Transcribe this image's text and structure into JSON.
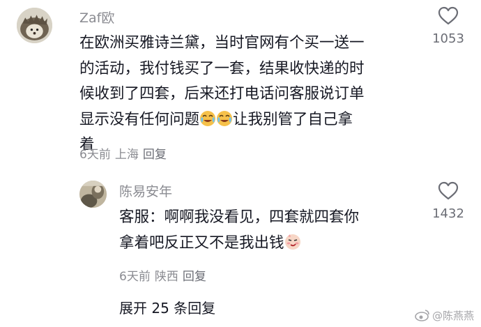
{
  "comment": {
    "author": "Zaf欧",
    "lines": [
      "在欧洲买雅诗兰黛，当时官网有个买一送一",
      "的活动，我付钱买了一套，结果收快递的时",
      "候收到了四套，后来还打电话问客服说订单",
      "显示没有任何问题",
      "让我别管了自己拿",
      "着"
    ],
    "time": "6天前",
    "location": "上海",
    "reply_label": "回复",
    "likes": "1053",
    "emoji": "crying-laughing-emoji"
  },
  "reply": {
    "author": "陈易安年",
    "lines": [
      "客服：啊啊我没看见，四套就四套你",
      "拿着吧反正又不是我出钱"
    ],
    "time": "6天前",
    "location": "陕西",
    "reply_label": "回复",
    "likes": "1432",
    "emoji": "smirk-emoji"
  },
  "expand_label": "展开 25 条回复",
  "watermark": "@陈燕燕",
  "colors": {
    "username": "#8a8b91",
    "text": "#161823",
    "meta": "#8a8b91",
    "icon": "#6b6d75"
  }
}
